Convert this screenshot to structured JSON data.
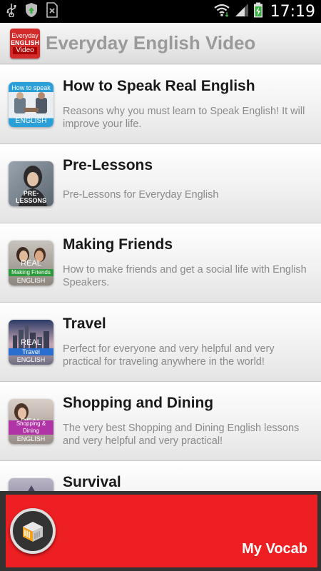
{
  "status_bar": {
    "time": "17:19",
    "icons": [
      "usb-icon",
      "shield-update-icon",
      "sim-error-icon",
      "wifi-icon",
      "signal-icon",
      "battery-charging-icon"
    ]
  },
  "action_bar": {
    "logo_line1": "Everyday",
    "logo_line2": "ENGLISH",
    "logo_line3": "Video",
    "title": "Everyday English Video"
  },
  "lessons": [
    {
      "title": "How to Speak Real English",
      "description": "Reasons why you must learn to Speak English! It will improve your life.",
      "thumb_top": "How to speak",
      "thumb_bottom": "ENGLISH"
    },
    {
      "title": "Pre-Lessons",
      "description": "Pre-Lessons for Everyday English",
      "thumb_top": "",
      "thumb_bottom": "PRE-LESSONS"
    },
    {
      "title": "Making Friends",
      "description": "How to make friends and get a social life with English Speakers.",
      "thumb_top": "REAL",
      "thumb_mid": "Making Friends",
      "thumb_bottom": "ENGLISH"
    },
    {
      "title": "Travel",
      "description": "Perfect for everyone and very helpful and very practical for traveling anywhere in the world!",
      "thumb_top": "REAL",
      "thumb_mid": "Travel",
      "thumb_bottom": "ENGLISH"
    },
    {
      "title": "Shopping and Dining",
      "description": "The very best Shopping and Dining English lessons and very helpful and very practical!",
      "thumb_top": "REAL",
      "thumb_mid": "Shopping & Dining",
      "thumb_bottom": "ENGLISH"
    },
    {
      "title": "Survival",
      "description": "",
      "thumb_top": "",
      "thumb_bottom": ""
    }
  ],
  "bottom_bar": {
    "label": "My Vocab"
  },
  "colors": {
    "accent_red": "#ee1f22",
    "logo_red": "#d32a2a",
    "title_gray": "#9a9a9a"
  }
}
